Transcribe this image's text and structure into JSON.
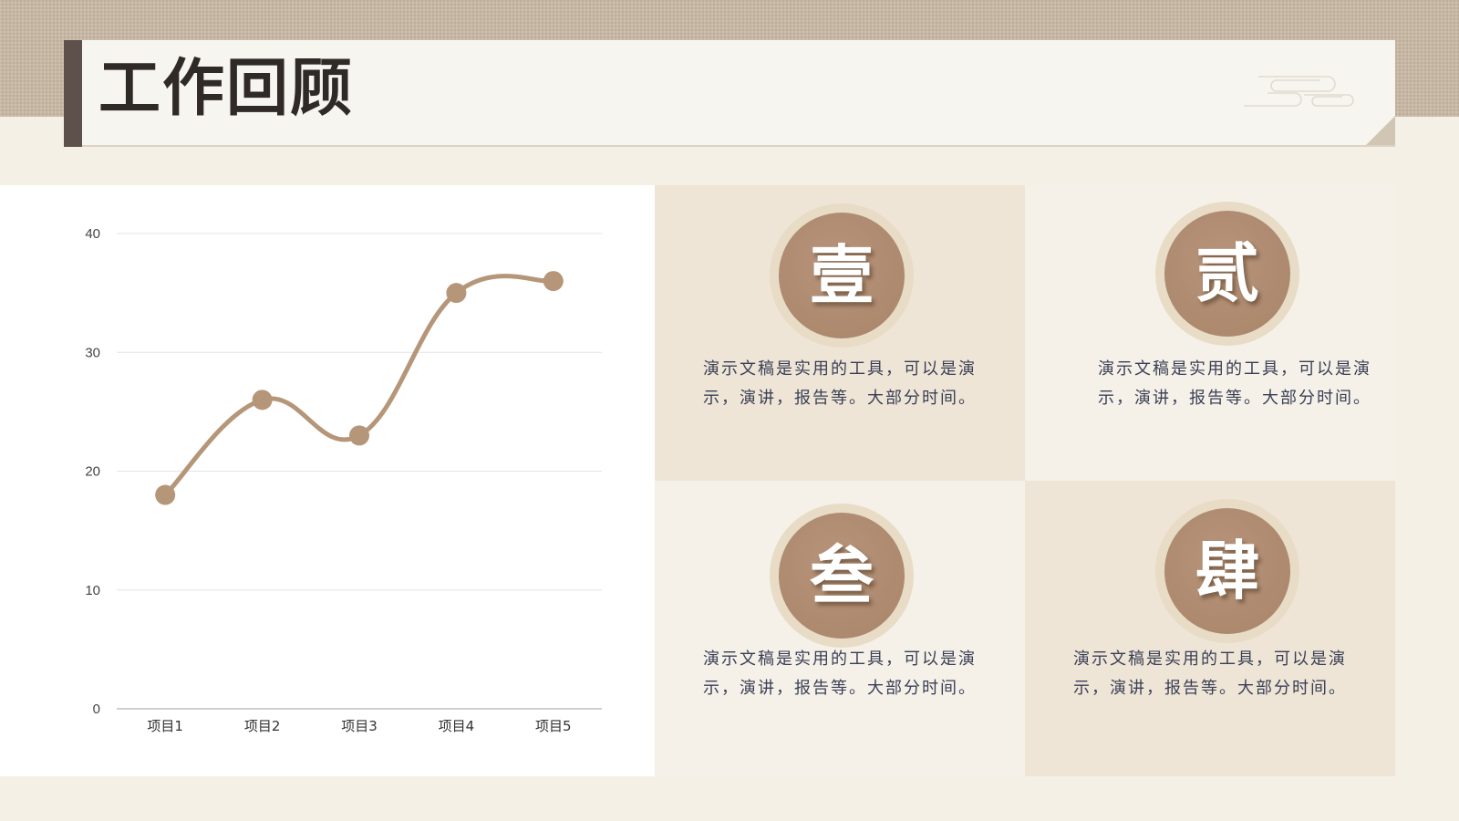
{
  "header": {
    "title": "工作回顾"
  },
  "chart_data": {
    "type": "line",
    "categories": [
      "项目1",
      "项目2",
      "项目3",
      "项目4",
      "项目5"
    ],
    "values": [
      18,
      26,
      23,
      35,
      36
    ],
    "ylim": [
      0,
      40
    ],
    "yticks": [
      "0",
      "10",
      "20",
      "30",
      "40"
    ],
    "grid": true,
    "smooth": true,
    "color": "#b59679"
  },
  "cards": [
    {
      "numeral": "壹",
      "text": "演示文稿是实用的工具，可以是演示，演讲，报告等。大部分时间。"
    },
    {
      "numeral": "贰",
      "text": "演示文稿是实用的工具，可以是演示，演讲，报告等。大部分时间。"
    },
    {
      "numeral": "叁",
      "text": "演示文稿是实用的工具，可以是演示，演讲，报告等。大部分时间。"
    },
    {
      "numeral": "肆",
      "text": "演示文稿是实用的工具，可以是演示，演讲，报告等。大部分时间。"
    }
  ],
  "colors": {
    "accent": "#b59679",
    "title_bar_accent": "#5e504a",
    "badge": "#ac896d",
    "card_dark": "#eee5d6",
    "card_light": "#f5f1e8",
    "text": "#3a3f55"
  },
  "icons": {
    "decoration": "cloud-scroll-icon"
  }
}
